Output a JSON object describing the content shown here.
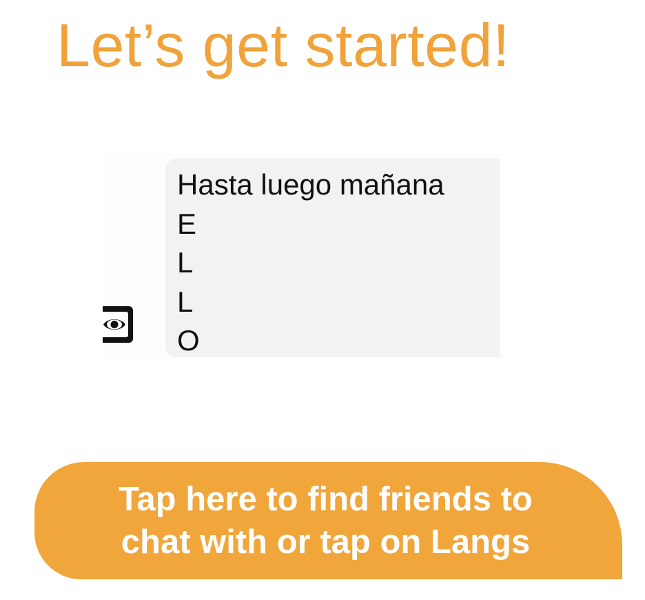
{
  "header": {
    "title": "Let’s get started!"
  },
  "message_preview": {
    "lines": [
      "Hasta luego mañana",
      "E",
      "L",
      "L",
      "O"
    ],
    "view_icon": "view-once-icon"
  },
  "cta": {
    "label": "Tap here to find friends to chat with or tap on Langs"
  },
  "colors": {
    "accent": "#F0A33A",
    "button": "#F0A63B",
    "bubble_background": "#F2F2F2",
    "text_dark": "#111111",
    "text_light": "#FFFFFF"
  }
}
